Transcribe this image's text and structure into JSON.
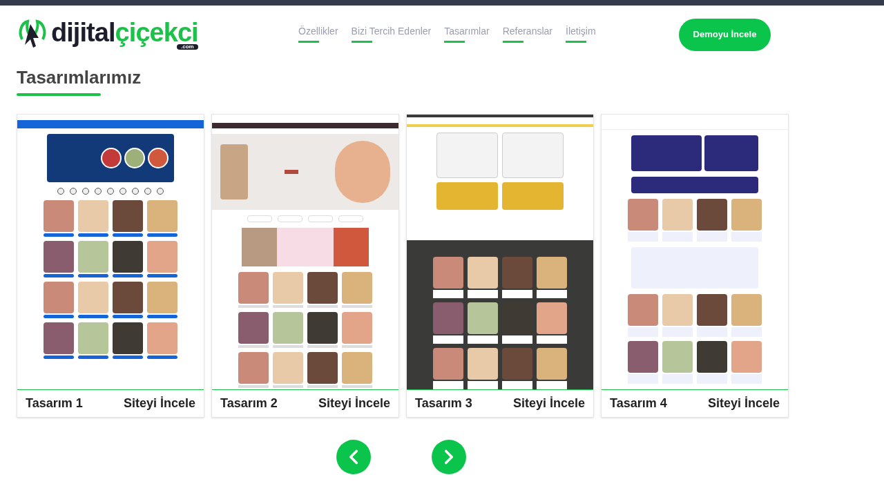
{
  "logo": {
    "word_1": "dijital",
    "word_2": "çiçekci",
    "badge": ".com"
  },
  "nav": [
    {
      "label": "Özellikler"
    },
    {
      "label": "Bizi Tercih Edenler"
    },
    {
      "label": "Tasarımlar"
    },
    {
      "label": "Referanslar"
    },
    {
      "label": "İletişim"
    }
  ],
  "cta_button": "Demoyu İncele",
  "section_title": "Tasarımlarımız",
  "designs": [
    {
      "title": "Tasarım 1",
      "link": "Siteyi İncele"
    },
    {
      "title": "Tasarım 2",
      "link": "Siteyi İncele"
    },
    {
      "title": "Tasarım 3",
      "link": "Siteyi İncele"
    },
    {
      "title": "Tasarım 4",
      "link": "Siteyi İncele"
    }
  ]
}
